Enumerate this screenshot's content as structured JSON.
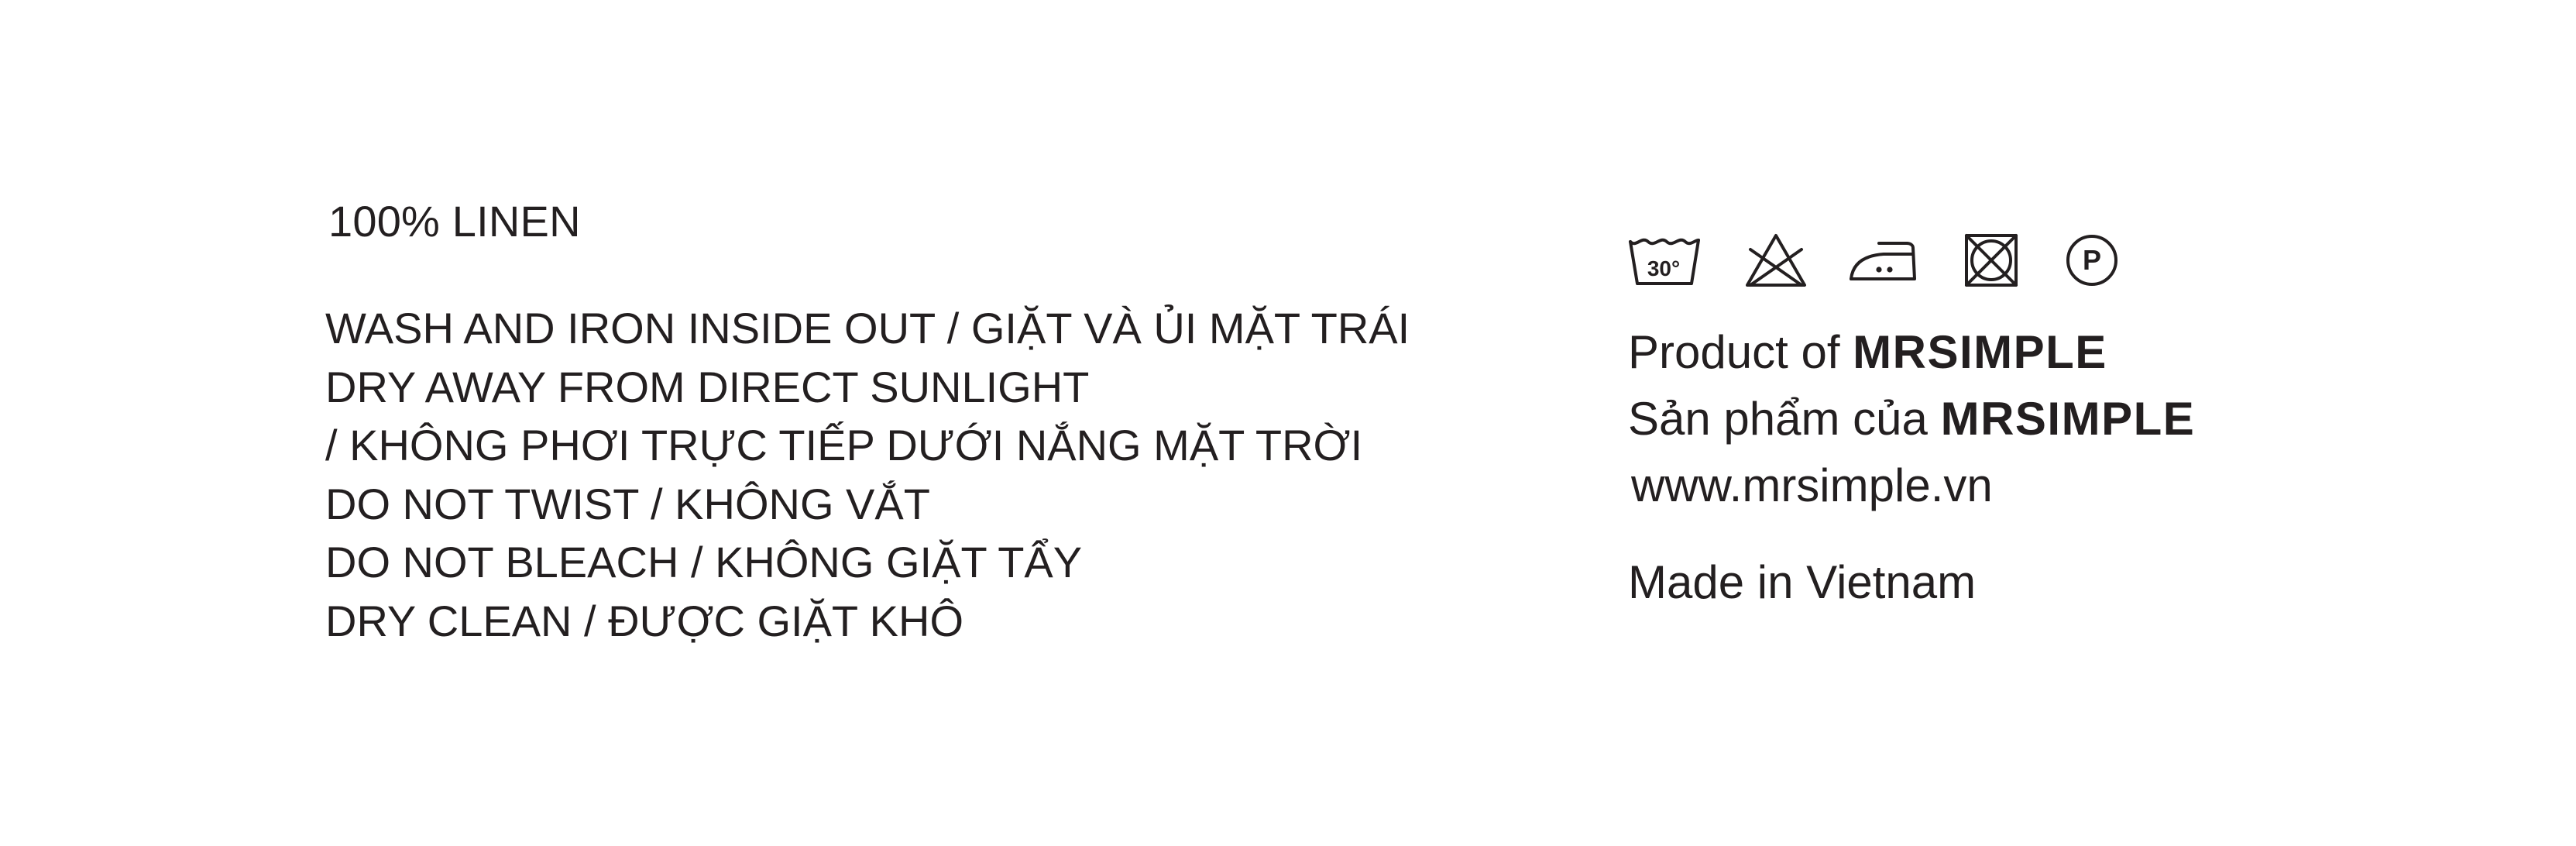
{
  "label": {
    "fabric": "100% LINEN",
    "care_instructions": [
      "WASH AND IRON INSIDE OUT / GIẶT VÀ ỦI MẶT TRÁI",
      "DRY AWAY FROM DIRECT SUNLIGHT",
      "/ KHÔNG PHƠI TRỰC TIẾP DƯỚI NẮNG MẶT TRỜI",
      "DO NOT TWIST / KHÔNG VẮT",
      "DO NOT BLEACH / KHÔNG GIẶT TẨY",
      "DRY CLEAN / ĐƯỢC GIẶT KHÔ"
    ],
    "care_symbols": {
      "wash_temperature": "30°",
      "dry_clean_letter": "P",
      "icons": [
        "wash-30-icon",
        "do-not-bleach-icon",
        "iron-low-heat-icon",
        "do-not-tumble-dry-icon",
        "dry-clean-p-icon"
      ]
    },
    "brand": {
      "product_of_prefix": "Product of ",
      "name": "MRSIMPLE",
      "vi_prefix": "Sản phẩm của ",
      "website": "www.mrsimple.vn"
    },
    "origin": "Made in Vietnam",
    "colors": {
      "ink": "#231f20",
      "background": "#ffffff"
    }
  }
}
